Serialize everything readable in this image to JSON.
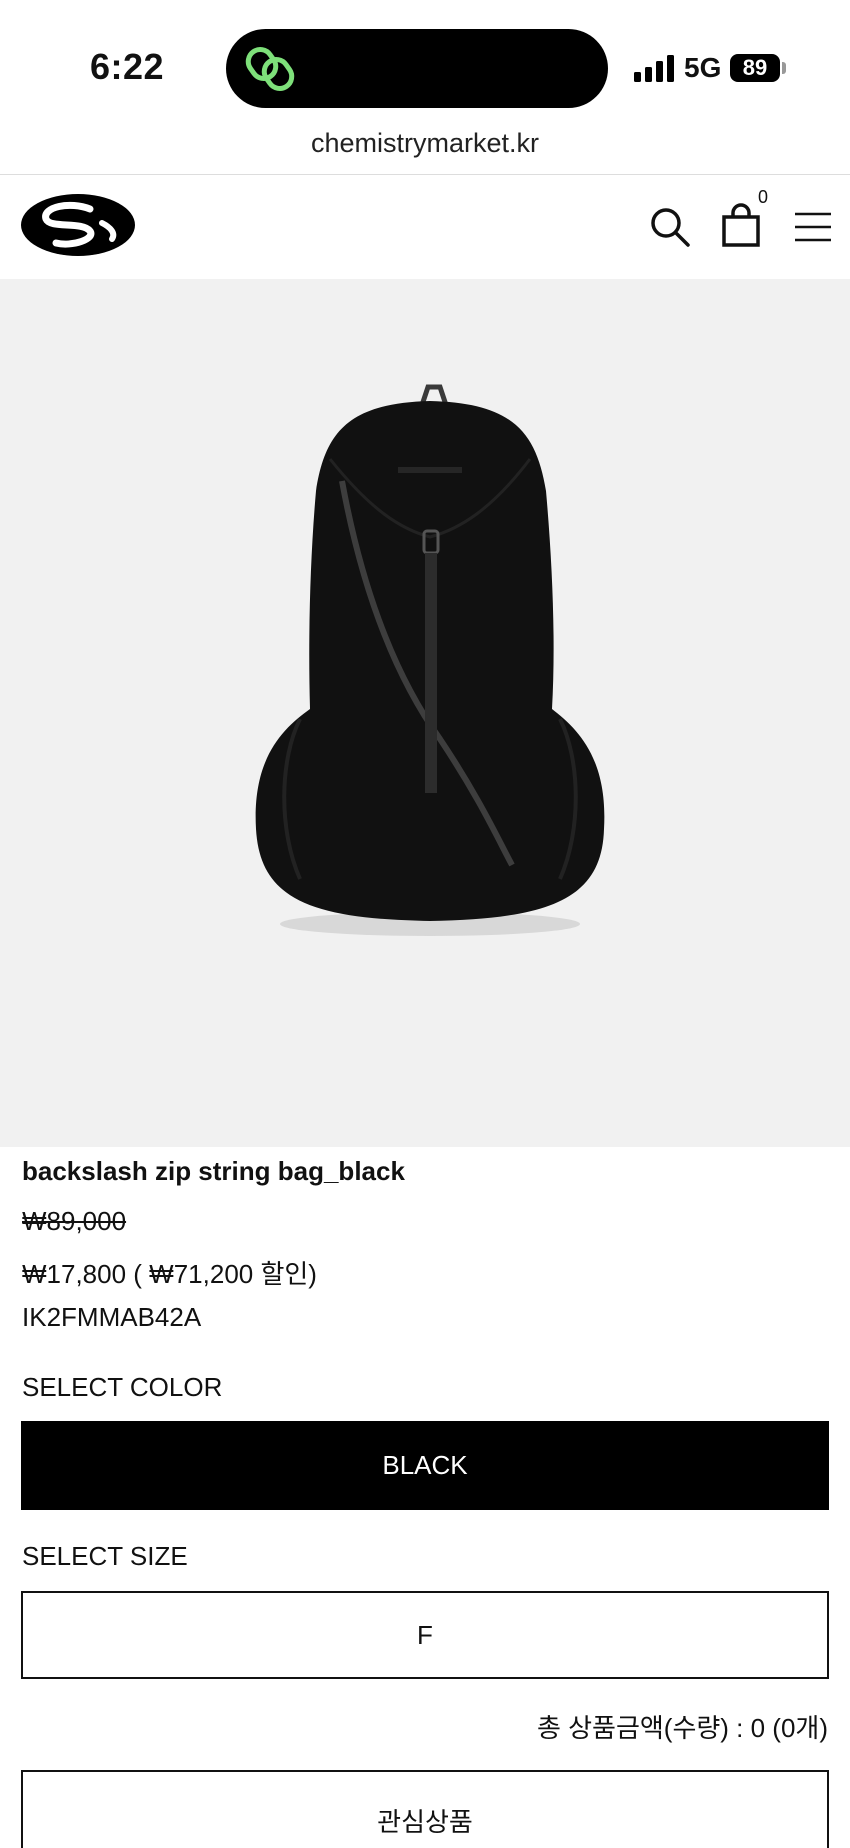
{
  "status_bar": {
    "time": "6:22",
    "network": "5G",
    "battery": "89"
  },
  "browser": {
    "url": "chemistrymarket.kr"
  },
  "header": {
    "cart_count": "0",
    "icons": [
      "logo",
      "search-icon",
      "shopping-bag-icon",
      "hamburger-menu-icon"
    ]
  },
  "product": {
    "name": "backslash zip string bag_black",
    "original_price": "₩89,000",
    "sale_price": "₩17,800 ( ₩71,200 할인)",
    "code": "IK2FMMAB42A"
  },
  "options": {
    "color_label": "SELECT COLOR",
    "color_value": "BLACK",
    "size_label": "SELECT SIZE",
    "size_value": "F"
  },
  "summary": {
    "total": "총 상품금액(수량) : 0 (0개)"
  },
  "actions": {
    "wishlist_label": "관심상품"
  },
  "colors": {
    "image_bg": "#f1f1f1",
    "primary": "#000000",
    "island_icon": "#7ee07a"
  }
}
